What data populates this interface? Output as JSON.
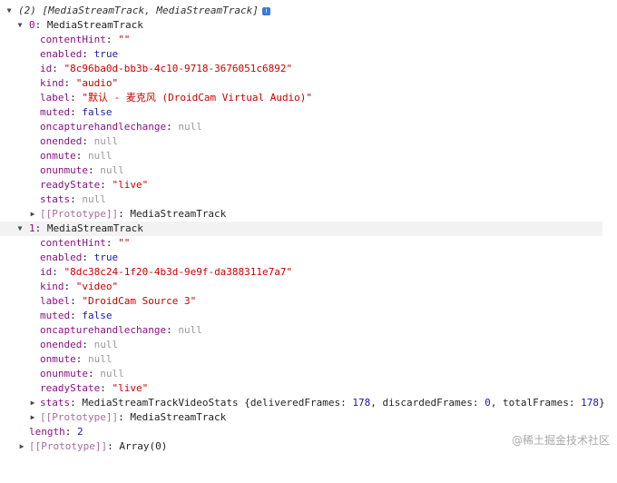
{
  "header": {
    "count": "(2)",
    "summary": "[MediaStreamTrack, MediaStreamTrack]",
    "info_icon": "i"
  },
  "sep": ": ",
  "t0": {
    "index": "0",
    "type": "MediaStreamTrack",
    "contentHint_k": "contentHint",
    "contentHint_v": "\"\"",
    "enabled_k": "enabled",
    "enabled_v": "true",
    "id_k": "id",
    "id_v": "\"8c96ba0d-bb3b-4c10-9718-3676051c6892\"",
    "kind_k": "kind",
    "kind_v": "\"audio\"",
    "label_k": "label",
    "label_v": "\"默认 - 麦克风 (DroidCam Virtual Audio)\"",
    "muted_k": "muted",
    "muted_v": "false",
    "och_k": "oncapturehandlechange",
    "och_v": "null",
    "onended_k": "onended",
    "onended_v": "null",
    "onmute_k": "onmute",
    "onmute_v": "null",
    "onunmute_k": "onunmute",
    "onunmute_v": "null",
    "ready_k": "readyState",
    "ready_v": "\"live\"",
    "stats_k": "stats",
    "stats_v": "null",
    "proto_k": "[[Prototype]]",
    "proto_v": "MediaStreamTrack"
  },
  "t1": {
    "index": "1",
    "type": "MediaStreamTrack",
    "contentHint_k": "contentHint",
    "contentHint_v": "\"\"",
    "enabled_k": "enabled",
    "enabled_v": "true",
    "id_k": "id",
    "id_v": "\"8dc38c24-1f20-4b3d-9e9f-da388311e7a7\"",
    "kind_k": "kind",
    "kind_v": "\"video\"",
    "label_k": "label",
    "label_v": "\"DroidCam Source 3\"",
    "muted_k": "muted",
    "muted_v": "false",
    "och_k": "oncapturehandlechange",
    "och_v": "null",
    "onended_k": "onended",
    "onended_v": "null",
    "onmute_k": "onmute",
    "onmute_v": "null",
    "onunmute_k": "onunmute",
    "onunmute_v": "null",
    "ready_k": "readyState",
    "ready_v": "\"live\"",
    "stats_k": "stats",
    "stats_type": "MediaStreamTrackVideoStats",
    "stats_open": "{",
    "stats_close": "}",
    "comma": ", ",
    "delivered_k": "deliveredFrames",
    "delivered_v": "178",
    "discarded_k": "discardedFrames",
    "discarded_v": "0",
    "total_k": "totalFrames",
    "total_v": "178",
    "proto_k": "[[Prototype]]",
    "proto_v": "MediaStreamTrack"
  },
  "length_k": "length",
  "length_v": "2",
  "array_proto_k": "[[Prototype]]",
  "array_proto_v": "Array(0)",
  "watermark": "@稀土掘金技术社区"
}
